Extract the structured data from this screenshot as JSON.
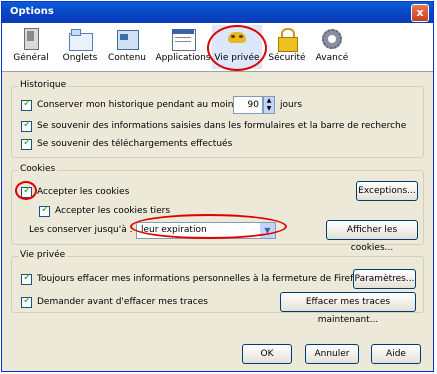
{
  "window": {
    "title": "Options",
    "close_label": "x"
  },
  "toolbar": [
    {
      "label": "Général",
      "icon": "general-icon"
    },
    {
      "label": "Onglets",
      "icon": "tabs-icon"
    },
    {
      "label": "Contenu",
      "icon": "content-icon"
    },
    {
      "label": "Applications",
      "icon": "applications-icon"
    },
    {
      "label": "Vie privée",
      "icon": "privacy-mask-icon",
      "selected": true
    },
    {
      "label": "Sécurité",
      "icon": "lock-icon"
    },
    {
      "label": "Avancé",
      "icon": "gear-icon"
    }
  ],
  "historique": {
    "legend": "Historique",
    "history_label": "Conserver mon historique pendant au moins",
    "history_days": "90",
    "days_unit": "jours",
    "forms_label": "Se souvenir des informations saisies dans les formulaires et la barre de recherche",
    "downloads_label": "Se souvenir des téléchargements effectués"
  },
  "cookies": {
    "legend": "Cookies",
    "accept_label": "Accepter les cookies",
    "exceptions_button": "Exceptions...",
    "third_party_label": "Accepter les cookies tiers",
    "keep_label": "Les conserver jusqu'à :",
    "keep_value": "leur expiration",
    "show_cookies_button": "Afficher les cookies..."
  },
  "vie_privee": {
    "legend": "Vie privée",
    "always_clear_label": "Toujours effacer mes informations personnelles à la fermeture de Firefox",
    "settings_button": "Paramètres...",
    "ask_label": "Demander avant d'effacer mes traces",
    "clear_now_button": "Effacer mes traces maintenant..."
  },
  "footer": {
    "ok": "OK",
    "cancel": "Annuler",
    "help": "Aide"
  },
  "colors": {
    "highlight_ring": "#e00000",
    "titlebar": "#0847c7"
  }
}
